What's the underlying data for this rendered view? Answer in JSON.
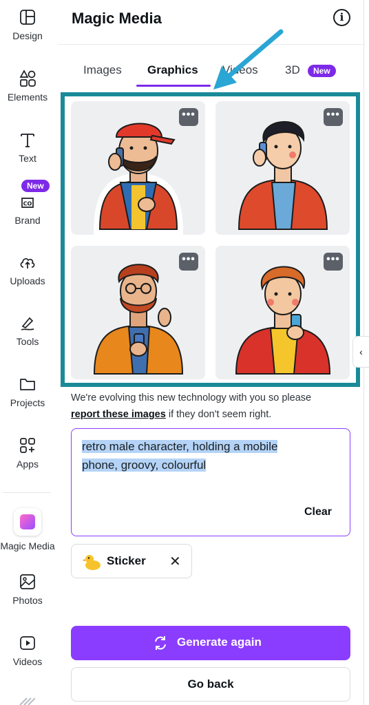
{
  "sidebar": {
    "items": [
      {
        "label": "Design",
        "icon": "layout-icon"
      },
      {
        "label": "Elements",
        "icon": "shapes-icon"
      },
      {
        "label": "Text",
        "icon": "text-icon"
      },
      {
        "label": "Brand",
        "icon": "brand-icon",
        "badge": "New"
      },
      {
        "label": "Uploads",
        "icon": "cloud-upload-icon"
      },
      {
        "label": "Tools",
        "icon": "pen-tool-icon"
      },
      {
        "label": "Projects",
        "icon": "folder-icon"
      },
      {
        "label": "Apps",
        "icon": "apps-icon"
      },
      {
        "label": "Magic Media",
        "icon": "magic-media-icon"
      },
      {
        "label": "Photos",
        "icon": "photo-icon"
      },
      {
        "label": "Videos",
        "icon": "video-icon"
      }
    ]
  },
  "panel": {
    "title": "Magic Media",
    "info_icon": "i",
    "tabs": [
      {
        "label": "Images"
      },
      {
        "label": "Graphics",
        "active": true
      },
      {
        "label": "Videos"
      },
      {
        "label": "3D",
        "badge": "New"
      }
    ],
    "results": [
      {
        "more": "•••"
      },
      {
        "more": "•••"
      },
      {
        "more": "•••"
      },
      {
        "more": "•••"
      }
    ],
    "notice_text": "We're evolving this new technology with you so please",
    "notice_link": "report these images",
    "notice_tail": " if they don't seem right.",
    "prompt": "retro male character, holding a mobile phone, groovy, colourful",
    "clear_label": "Clear",
    "style_chip": "Sticker",
    "style_chip_remove": "✕",
    "generate_label": "Generate again",
    "back_label": "Go back"
  },
  "colors": {
    "accent": "#8b3dff",
    "badge": "#7d2ae8",
    "highlight_frame": "#1a8a98",
    "arrow": "#2aa6d4"
  }
}
